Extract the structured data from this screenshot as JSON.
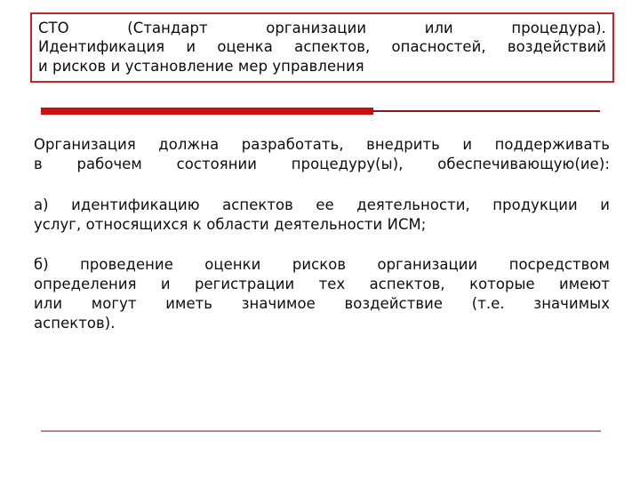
{
  "slide": {
    "background_color": "#ffffff",
    "title_box": {
      "border_color": "#c0272d",
      "lines": [
        "CTO (Стандарт организации или процедура).",
        "Идентификация и оценка аспектов, опасностей, воздействий",
        "и рисков  и установление мер управления"
      ]
    },
    "divider_top": {
      "thick_bar_color": "#c9100c",
      "thin_line_color": "#7c1a22"
    },
    "divider_bottom": {
      "color": "#b2878d"
    },
    "body": {
      "paragraphs": [
        {
          "id": "intro",
          "lines": [
            "Организация должна разработать, внедрить и поддерживать",
            "в рабочем  состоянии  процедуру(ы), обеспечивающую(ие):"
          ]
        },
        {
          "id": "item-a",
          "lines": [
            "а) идентификацию аспектов ее деятельности, продукции и",
            "услуг, относящихся к области деятельности ИСМ;"
          ]
        },
        {
          "id": "item-b",
          "lines": [
            "б) проведение оценки рисков организации посредством",
            "определения и регистрации тех аспектов, которые имеют",
            "или могут иметь значимое воздействие (т.е. значимых",
            "аспектов)."
          ]
        }
      ]
    }
  }
}
